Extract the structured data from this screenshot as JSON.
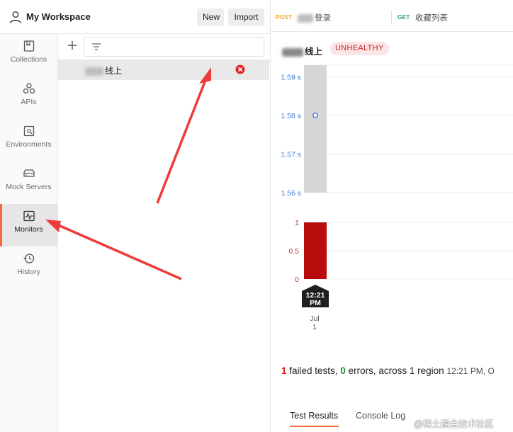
{
  "header": {
    "workspace_title": "My Workspace",
    "new_label": "New",
    "import_label": "Import"
  },
  "sidebar": {
    "items": [
      {
        "label": "Collections",
        "icon": "collections-icon"
      },
      {
        "label": "APIs",
        "icon": "apis-icon"
      },
      {
        "label": "Environments",
        "icon": "environments-icon"
      },
      {
        "label": "Mock Servers",
        "icon": "mock-servers-icon"
      },
      {
        "label": "Monitors",
        "icon": "monitors-icon",
        "active": true
      },
      {
        "label": "History",
        "icon": "history-icon"
      }
    ]
  },
  "monitor_list": {
    "items": [
      {
        "label": "线上",
        "status": "error"
      }
    ]
  },
  "request_tabs": [
    {
      "method": "POST",
      "name": "登录",
      "method_color": "#f5a623"
    },
    {
      "method": "GET",
      "name": "收藏列表",
      "method_color": "#2aa876"
    }
  ],
  "monitor": {
    "name": "线上",
    "status_badge": "UNHEALTHY"
  },
  "chart_data": [
    {
      "type": "bar",
      "title": "",
      "ylabel": "",
      "y_ticks": [
        "1.59 s",
        "1.58 s",
        "1.57 s",
        "1.56 s"
      ],
      "ylim": [
        1.56,
        1.593
      ],
      "series": [
        {
          "values": [
            1.58
          ],
          "point": 1.58
        }
      ],
      "categories": [
        "Jul 1"
      ]
    },
    {
      "type": "bar",
      "title": "",
      "ylabel": "",
      "y_ticks": [
        "1",
        "0.5",
        "0"
      ],
      "ylim": [
        0,
        1
      ],
      "series": [
        {
          "values": [
            1
          ]
        }
      ],
      "categories": [
        "Jul 1"
      ],
      "time_marker": "12:21 PM",
      "x_label_top": "Jul",
      "x_label_bottom": "1"
    }
  ],
  "summary": {
    "failed_count": "1",
    "failed_text": " failed tests, ",
    "error_count": "0",
    "error_text": " errors, across 1 region",
    "time": "12:21 PM, O"
  },
  "bottom_tabs": {
    "test_results": "Test Results",
    "console_log": "Console Log"
  },
  "watermark": "@稀土掘金技术社区",
  "colors": {
    "accent": "#f26b3a",
    "error": "#d11f1f",
    "error_bar": "#b80c0c",
    "response_bar": "#d6d6d6",
    "blue_tick": "#3b7bd0",
    "red_tick": "#c0392b",
    "arrow": "#ee3b3b"
  }
}
